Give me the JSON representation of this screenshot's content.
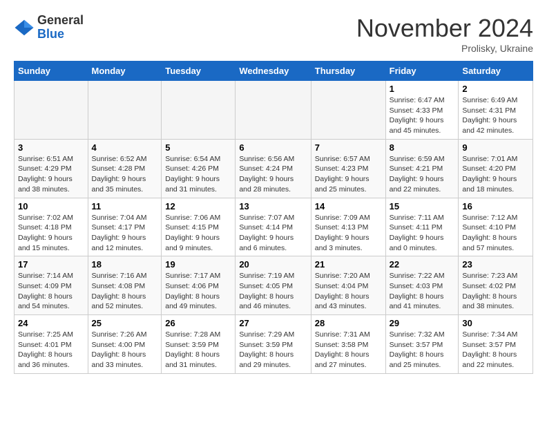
{
  "logo": {
    "general": "General",
    "blue": "Blue"
  },
  "title": "November 2024",
  "subtitle": "Prolisky, Ukraine",
  "days_of_week": [
    "Sunday",
    "Monday",
    "Tuesday",
    "Wednesday",
    "Thursday",
    "Friday",
    "Saturday"
  ],
  "weeks": [
    [
      {
        "day": "",
        "info": ""
      },
      {
        "day": "",
        "info": ""
      },
      {
        "day": "",
        "info": ""
      },
      {
        "day": "",
        "info": ""
      },
      {
        "day": "",
        "info": ""
      },
      {
        "day": "1",
        "info": "Sunrise: 6:47 AM\nSunset: 4:33 PM\nDaylight: 9 hours and 45 minutes."
      },
      {
        "day": "2",
        "info": "Sunrise: 6:49 AM\nSunset: 4:31 PM\nDaylight: 9 hours and 42 minutes."
      }
    ],
    [
      {
        "day": "3",
        "info": "Sunrise: 6:51 AM\nSunset: 4:29 PM\nDaylight: 9 hours and 38 minutes."
      },
      {
        "day": "4",
        "info": "Sunrise: 6:52 AM\nSunset: 4:28 PM\nDaylight: 9 hours and 35 minutes."
      },
      {
        "day": "5",
        "info": "Sunrise: 6:54 AM\nSunset: 4:26 PM\nDaylight: 9 hours and 31 minutes."
      },
      {
        "day": "6",
        "info": "Sunrise: 6:56 AM\nSunset: 4:24 PM\nDaylight: 9 hours and 28 minutes."
      },
      {
        "day": "7",
        "info": "Sunrise: 6:57 AM\nSunset: 4:23 PM\nDaylight: 9 hours and 25 minutes."
      },
      {
        "day": "8",
        "info": "Sunrise: 6:59 AM\nSunset: 4:21 PM\nDaylight: 9 hours and 22 minutes."
      },
      {
        "day": "9",
        "info": "Sunrise: 7:01 AM\nSunset: 4:20 PM\nDaylight: 9 hours and 18 minutes."
      }
    ],
    [
      {
        "day": "10",
        "info": "Sunrise: 7:02 AM\nSunset: 4:18 PM\nDaylight: 9 hours and 15 minutes."
      },
      {
        "day": "11",
        "info": "Sunrise: 7:04 AM\nSunset: 4:17 PM\nDaylight: 9 hours and 12 minutes."
      },
      {
        "day": "12",
        "info": "Sunrise: 7:06 AM\nSunset: 4:15 PM\nDaylight: 9 hours and 9 minutes."
      },
      {
        "day": "13",
        "info": "Sunrise: 7:07 AM\nSunset: 4:14 PM\nDaylight: 9 hours and 6 minutes."
      },
      {
        "day": "14",
        "info": "Sunrise: 7:09 AM\nSunset: 4:13 PM\nDaylight: 9 hours and 3 minutes."
      },
      {
        "day": "15",
        "info": "Sunrise: 7:11 AM\nSunset: 4:11 PM\nDaylight: 9 hours and 0 minutes."
      },
      {
        "day": "16",
        "info": "Sunrise: 7:12 AM\nSunset: 4:10 PM\nDaylight: 8 hours and 57 minutes."
      }
    ],
    [
      {
        "day": "17",
        "info": "Sunrise: 7:14 AM\nSunset: 4:09 PM\nDaylight: 8 hours and 54 minutes."
      },
      {
        "day": "18",
        "info": "Sunrise: 7:16 AM\nSunset: 4:08 PM\nDaylight: 8 hours and 52 minutes."
      },
      {
        "day": "19",
        "info": "Sunrise: 7:17 AM\nSunset: 4:06 PM\nDaylight: 8 hours and 49 minutes."
      },
      {
        "day": "20",
        "info": "Sunrise: 7:19 AM\nSunset: 4:05 PM\nDaylight: 8 hours and 46 minutes."
      },
      {
        "day": "21",
        "info": "Sunrise: 7:20 AM\nSunset: 4:04 PM\nDaylight: 8 hours and 43 minutes."
      },
      {
        "day": "22",
        "info": "Sunrise: 7:22 AM\nSunset: 4:03 PM\nDaylight: 8 hours and 41 minutes."
      },
      {
        "day": "23",
        "info": "Sunrise: 7:23 AM\nSunset: 4:02 PM\nDaylight: 8 hours and 38 minutes."
      }
    ],
    [
      {
        "day": "24",
        "info": "Sunrise: 7:25 AM\nSunset: 4:01 PM\nDaylight: 8 hours and 36 minutes."
      },
      {
        "day": "25",
        "info": "Sunrise: 7:26 AM\nSunset: 4:00 PM\nDaylight: 8 hours and 33 minutes."
      },
      {
        "day": "26",
        "info": "Sunrise: 7:28 AM\nSunset: 3:59 PM\nDaylight: 8 hours and 31 minutes."
      },
      {
        "day": "27",
        "info": "Sunrise: 7:29 AM\nSunset: 3:59 PM\nDaylight: 8 hours and 29 minutes."
      },
      {
        "day": "28",
        "info": "Sunrise: 7:31 AM\nSunset: 3:58 PM\nDaylight: 8 hours and 27 minutes."
      },
      {
        "day": "29",
        "info": "Sunrise: 7:32 AM\nSunset: 3:57 PM\nDaylight: 8 hours and 25 minutes."
      },
      {
        "day": "30",
        "info": "Sunrise: 7:34 AM\nSunset: 3:57 PM\nDaylight: 8 hours and 22 minutes."
      }
    ]
  ]
}
